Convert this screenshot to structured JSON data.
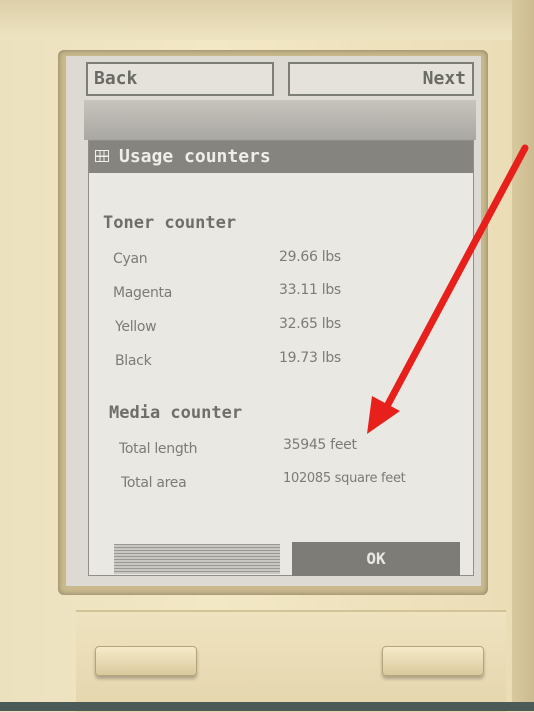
{
  "nav": {
    "back_label": "Back",
    "next_label": "Next"
  },
  "dialog": {
    "icon": "grid-icon",
    "title": "Usage counters",
    "toner": {
      "heading": "Toner counter",
      "rows": [
        {
          "label": "Cyan",
          "value": "29.66 lbs"
        },
        {
          "label": "Magenta",
          "value": "33.11 lbs"
        },
        {
          "label": "Yellow",
          "value": "32.65 lbs"
        },
        {
          "label": "Black",
          "value": "19.73 lbs"
        }
      ]
    },
    "media": {
      "heading": "Media counter",
      "rows": [
        {
          "label": "Total length",
          "value": "35945 feet"
        },
        {
          "label": "Total area",
          "value": "102085 square feet"
        }
      ]
    },
    "ok_label": "OK"
  },
  "annotation": {
    "color": "#e8201c"
  }
}
